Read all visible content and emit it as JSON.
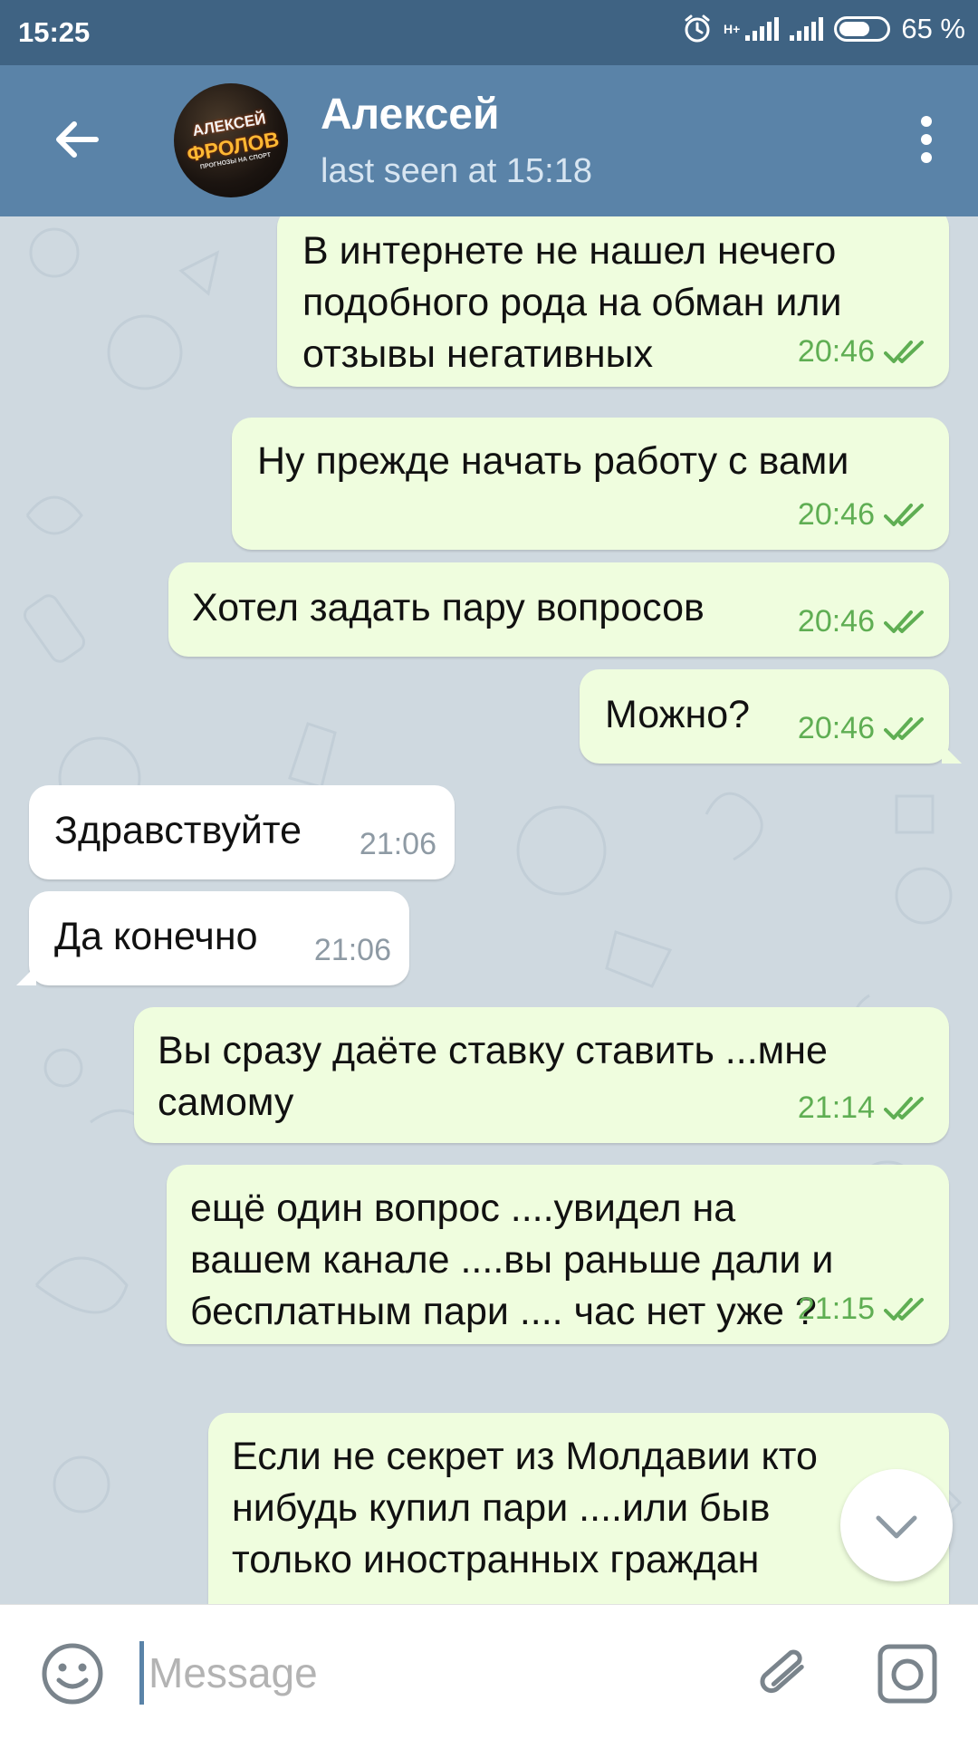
{
  "status_bar": {
    "time": "15:25",
    "battery": "65 %",
    "battery_level": 0.65,
    "network_label": "H+"
  },
  "header": {
    "contact_name": "Алексей",
    "last_seen": "last seen at 15:18",
    "avatar_text": [
      "АЛЕКСЕЙ",
      "ФРОЛОВ",
      "ПРОГНОЗЫ НА СПОРТ"
    ],
    "back_icon": "arrow-left-icon",
    "menu_icon": "more-vertical-icon"
  },
  "messages": [
    {
      "direction": "out",
      "lines": [
        "В интернете не нашел нечего",
        "подобного рода на обман или",
        "отзывы негативных"
      ],
      "time": "20:46",
      "read": true
    },
    {
      "direction": "out",
      "lines": [
        "Ну прежде начать работу с вами"
      ],
      "time": "20:46",
      "read": true
    },
    {
      "direction": "out",
      "lines": [
        "Хотел задать пару вопросов"
      ],
      "time": "20:46",
      "read": true
    },
    {
      "direction": "out",
      "lines": [
        "Можно?"
      ],
      "time": "20:46",
      "read": true
    },
    {
      "direction": "in",
      "lines": [
        "Здравствуйте"
      ],
      "time": "21:06"
    },
    {
      "direction": "in",
      "lines": [
        "Да конечно"
      ],
      "time": "21:06"
    },
    {
      "direction": "out",
      "lines": [
        "Вы сразу даёте ставку ставить ...мне",
        "самому"
      ],
      "time": "21:14",
      "read": true
    },
    {
      "direction": "out",
      "lines": [
        "ещё один вопрос ....увидел на",
        "вашем канале ....вы раньше дали и",
        "бесплатным пари .... час нет уже ?"
      ],
      "time": "21:15",
      "read": true
    },
    {
      "direction": "out",
      "lines": [
        "Если не секрет из Молдавии кто",
        "нибудь купил пари ....или быв",
        "только иностранных граждан"
      ],
      "time": "",
      "read": false
    }
  ],
  "input": {
    "placeholder": "Message",
    "value": ""
  },
  "icons": {
    "emoji": "smile-icon",
    "attach": "paperclip-icon",
    "camera": "camera-icon",
    "scroll_down": "chevron-down-icon"
  },
  "colors": {
    "status_bar": "#3f6383",
    "header": "#5a83a8",
    "chat_background": "#cfd9e0",
    "outgoing_bubble": "#effdde",
    "incoming_bubble": "#ffffff",
    "outgoing_time": "#5fae53",
    "incoming_time": "#8e9aa4"
  }
}
